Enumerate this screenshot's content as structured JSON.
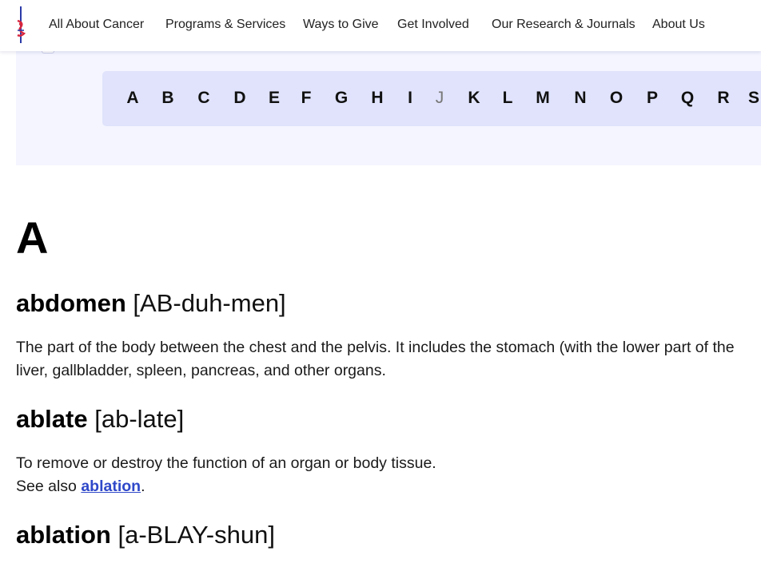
{
  "nav": {
    "logo_icon": "sword-ribbon-logo-icon",
    "items": [
      {
        "label": "All About Cancer"
      },
      {
        "label": "Programs & Services"
      },
      {
        "label": "Ways to Give"
      },
      {
        "label": "Get Involved"
      },
      {
        "label": "Our Research & Journals"
      },
      {
        "label": "About Us"
      }
    ]
  },
  "alphabet": {
    "letters": [
      {
        "char": "A",
        "enabled": true
      },
      {
        "char": "B",
        "enabled": true
      },
      {
        "char": "C",
        "enabled": true
      },
      {
        "char": "D",
        "enabled": true
      },
      {
        "char": "E",
        "enabled": true
      },
      {
        "char": "F",
        "enabled": true
      },
      {
        "char": "G",
        "enabled": true
      },
      {
        "char": "H",
        "enabled": true
      },
      {
        "char": "I",
        "enabled": true
      },
      {
        "char": "J",
        "enabled": false
      },
      {
        "char": "K",
        "enabled": true
      },
      {
        "char": "L",
        "enabled": true
      },
      {
        "char": "M",
        "enabled": true
      },
      {
        "char": "N",
        "enabled": true
      },
      {
        "char": "O",
        "enabled": true
      },
      {
        "char": "P",
        "enabled": true
      },
      {
        "char": "Q",
        "enabled": true
      },
      {
        "char": "R",
        "enabled": true
      },
      {
        "char": "S",
        "enabled": true
      }
    ]
  },
  "glossary": {
    "section_letter": "A",
    "terms": [
      {
        "word": "abdomen",
        "pronunciation": "[AB-duh-men]",
        "definition_line1": "The part of the body between the chest and the pelvis. It includes the stomach (with the lower part of the",
        "definition_line2": "liver, gallbladder, spleen, pancreas, and other organs."
      },
      {
        "word": "ablate",
        "pronunciation": "[ab-late]",
        "definition_line1": "To remove or destroy the function of an organ or body tissue.",
        "see_also_prefix": "See also ",
        "see_also_link": "ablation",
        "see_also_suffix": "."
      },
      {
        "word": "ablation",
        "pronunciation": "[a-BLAY-shun]"
      }
    ]
  },
  "colors": {
    "accent_link": "#2f48c9",
    "alpha_bar": "#e0e3fb",
    "alpha_band": "#f4f5ff",
    "logo_red": "#d7263d",
    "logo_blue": "#2b3aa8"
  }
}
